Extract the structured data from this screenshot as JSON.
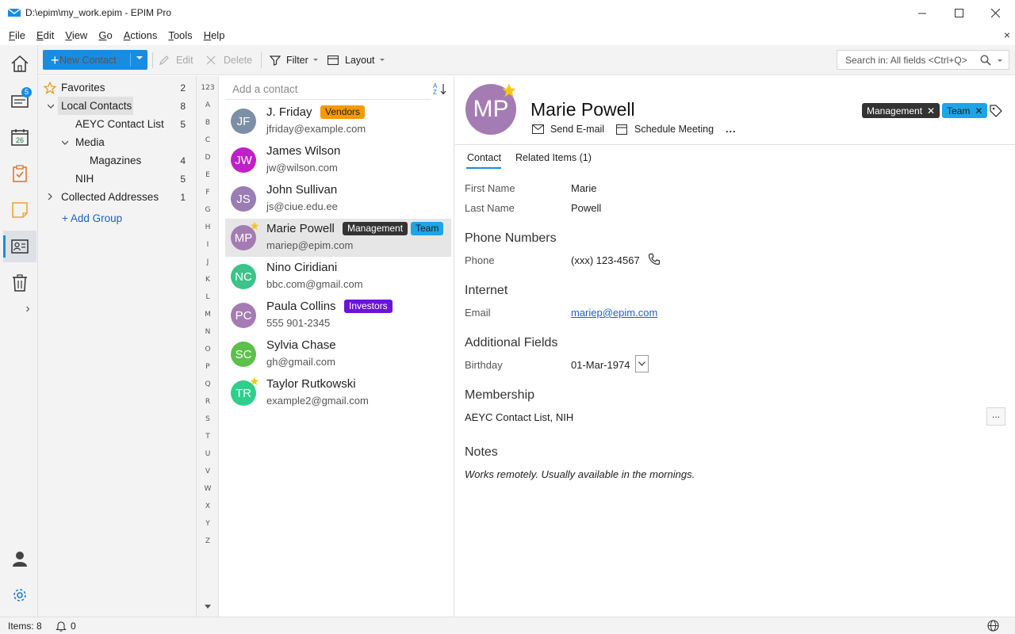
{
  "window": {
    "title": "D:\\epim\\my_work.epim - EPIM Pro",
    "minimize_icon": "minimize-icon",
    "maximize_icon": "maximize-icon",
    "close_icon": "close-icon"
  },
  "menu": {
    "items": [
      {
        "label": "File",
        "accel": "F"
      },
      {
        "label": "Edit",
        "accel": "E"
      },
      {
        "label": "View",
        "accel": "V"
      },
      {
        "label": "Go",
        "accel": "G"
      },
      {
        "label": "Actions",
        "accel": "A"
      },
      {
        "label": "Tools",
        "accel": "T"
      },
      {
        "label": "Help",
        "accel": "H"
      }
    ],
    "close_glyph": "×"
  },
  "toolbar": {
    "new_contact": "New Contact",
    "edit": "Edit",
    "delete": "Delete",
    "filter": "Filter",
    "layout": "Layout",
    "search_placeholder": "Search in: All fields  <Ctrl+Q>"
  },
  "nav": {
    "mail_badge": "5",
    "calendar_day": "26",
    "expand_glyph": "›"
  },
  "tree": {
    "favorites": {
      "label": "Favorites",
      "count": "2"
    },
    "local_contacts": {
      "label": "Local Contacts",
      "count": "8"
    },
    "aeyc": {
      "label": "AEYC Contact List",
      "count": "5"
    },
    "media": {
      "label": "Media",
      "count": ""
    },
    "magazines": {
      "label": "Magazines",
      "count": "4"
    },
    "nih": {
      "label": "NIH",
      "count": "5"
    },
    "collected": {
      "label": "Collected Addresses",
      "count": "1"
    },
    "add_group": "+  Add Group"
  },
  "alpha": [
    "123",
    "A",
    "B",
    "C",
    "D",
    "E",
    "F",
    "G",
    "H",
    "I",
    "J",
    "K",
    "L",
    "M",
    "N",
    "O",
    "P",
    "Q",
    "R",
    "S",
    "T",
    "U",
    "V",
    "W",
    "X",
    "Y",
    "Z"
  ],
  "list": {
    "add_placeholder": "Add a contact",
    "contacts": [
      {
        "initials": "JF",
        "name": "J. Friday",
        "sub": "jfriday@example.com",
        "color": "#7c8fa6",
        "tags": [
          {
            "label": "Vendors",
            "bg": "#f59a00",
            "fg": "#1f1f1f"
          }
        ],
        "star": false
      },
      {
        "initials": "JW",
        "name": "James Wilson",
        "sub": "jw@wilson.com",
        "color": "#c020c8",
        "tags": [],
        "star": false
      },
      {
        "initials": "JS",
        "name": "John Sullivan",
        "sub": "js@ciue.edu.ee",
        "color": "#9b7cb4",
        "tags": [],
        "star": false
      },
      {
        "initials": "MP",
        "name": "Marie Powell",
        "sub": "mariep@epim.com",
        "color": "#a57bb3",
        "tags": [
          {
            "label": "Management",
            "bg": "#333333",
            "fg": "#ffffff"
          },
          {
            "label": "Team",
            "bg": "#1aa6e8",
            "fg": "#1f1f1f"
          }
        ],
        "star": true
      },
      {
        "initials": "NC",
        "name": "Nino Ciridiani",
        "sub": "bbc.com@gmail.com",
        "color": "#3cc28a",
        "tags": [],
        "star": false
      },
      {
        "initials": "PC",
        "name": "Paula Collins",
        "sub": "555 901-2345",
        "color": "#a57bb3",
        "tags": [
          {
            "label": "Investors",
            "bg": "#6a14d6",
            "fg": "#ffffff"
          }
        ],
        "star": false
      },
      {
        "initials": "SC",
        "name": "Sylvia Chase",
        "sub": "gh@gmail.com",
        "color": "#5cc04a",
        "tags": [],
        "star": false
      },
      {
        "initials": "TR",
        "name": "Taylor Rutkowski",
        "sub": "example2@gmail.com",
        "color": "#2ecf8a",
        "tags": [],
        "star": true
      }
    ]
  },
  "detail": {
    "initials": "MP",
    "avatar_color": "#a57bb3",
    "name": "Marie Powell",
    "send_email": "Send E-mail",
    "schedule_meeting": "Schedule Meeting",
    "more": "...",
    "tags": [
      {
        "label": "Management",
        "bg": "#333333",
        "fg": "#ffffff"
      },
      {
        "label": "Team",
        "bg": "#1aa6e8",
        "fg": "#1f1f1f"
      }
    ],
    "tab_contact": "Contact",
    "tab_related": "Related Items  (1)",
    "first_name_label": "First Name",
    "first_name": "Marie",
    "last_name_label": "Last Name",
    "last_name": "Powell",
    "phone_section": "Phone Numbers",
    "phone_label": "Phone",
    "phone": "(xxx) 123-4567",
    "internet_section": "Internet",
    "email_label": "Email",
    "email": "mariep@epim.com",
    "additional_section": "Additional Fields",
    "birthday_label": "Birthday",
    "birthday": "01-Mar-1974",
    "membership_section": "Membership",
    "membership": "AEYC Contact List, NIH",
    "membership_more": "...",
    "notes_section": "Notes",
    "notes": "Works remotely. Usually available in the mornings."
  },
  "status": {
    "items": "Items: 8",
    "notifications": "0"
  }
}
